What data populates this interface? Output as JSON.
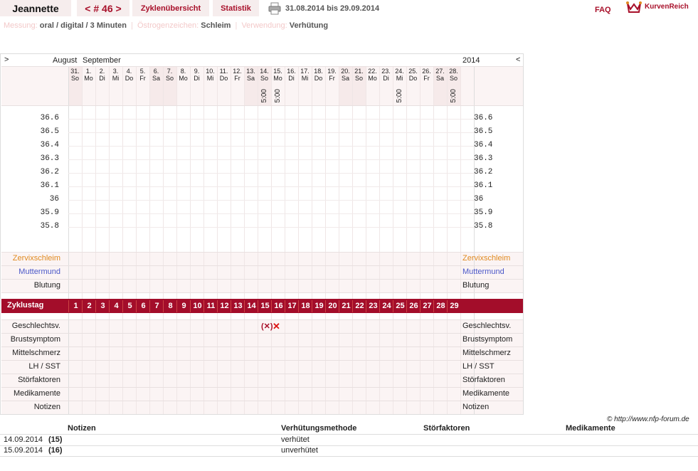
{
  "header": {
    "name": "Jeannette",
    "cycle_label": "< # 46 >",
    "overview_label": "Zyklenübersicht",
    "stats_label": "Statistik",
    "date_range": "31.08.2014 bis 29.09.2014",
    "faq_label": "FAQ",
    "logo_text": "KurvenReich",
    "accent_color": "#a8102a"
  },
  "subline": {
    "messung_label": "Messung:",
    "messung_value": "oral / digital / 3 Minuten",
    "oestrogen_label": "Östrogenzeichen:",
    "oestrogen_value": "Schleim",
    "verwendung_label": "Verwendung:",
    "verwendung_value": "Verhütung"
  },
  "chart": {
    "nav_left": ">",
    "nav_right": "<",
    "month1": "August",
    "month2": "September",
    "year": "2014",
    "days": [
      {
        "d": "31.",
        "w": "So",
        "wk": true
      },
      {
        "d": "1.",
        "w": "Mo"
      },
      {
        "d": "2.",
        "w": "Di"
      },
      {
        "d": "3.",
        "w": "Mi"
      },
      {
        "d": "4.",
        "w": "Do"
      },
      {
        "d": "5.",
        "w": "Fr"
      },
      {
        "d": "6.",
        "w": "Sa",
        "wk": true
      },
      {
        "d": "7.",
        "w": "So",
        "wk": true
      },
      {
        "d": "8.",
        "w": "Mo"
      },
      {
        "d": "9.",
        "w": "Di"
      },
      {
        "d": "10.",
        "w": "Mi"
      },
      {
        "d": "11.",
        "w": "Do"
      },
      {
        "d": "12.",
        "w": "Fr"
      },
      {
        "d": "13.",
        "w": "Sa",
        "wk": true
      },
      {
        "d": "14.",
        "w": "So",
        "wk": true,
        "t": "5:00"
      },
      {
        "d": "15.",
        "w": "Mo",
        "t": "5:00"
      },
      {
        "d": "16.",
        "w": "Di"
      },
      {
        "d": "17.",
        "w": "Mi"
      },
      {
        "d": "18.",
        "w": "Do"
      },
      {
        "d": "19.",
        "w": "Fr"
      },
      {
        "d": "20.",
        "w": "Sa",
        "wk": true
      },
      {
        "d": "21.",
        "w": "So",
        "wk": true
      },
      {
        "d": "22.",
        "w": "Mo"
      },
      {
        "d": "23.",
        "w": "Di"
      },
      {
        "d": "24.",
        "w": "Mi",
        "t": "5:00"
      },
      {
        "d": "25.",
        "w": "Do"
      },
      {
        "d": "26.",
        "w": "Fr"
      },
      {
        "d": "27.",
        "w": "Sa",
        "wk": true
      },
      {
        "d": "28.",
        "w": "So",
        "wk": true,
        "t": "5:00"
      }
    ],
    "temps": [
      "36.6",
      "36.5",
      "36.4",
      "36.3",
      "36.2",
      "36.1",
      "36",
      "35.9",
      "35.8"
    ],
    "labels": {
      "zervix": "Zervixschleim",
      "muttermund": "Muttermund",
      "blutung": "Blutung",
      "zyklustag": "Zyklustag",
      "geschlechtsv": "Geschlechtsv.",
      "brustsymptom": "Brustsymptom",
      "mittelschmerz": "Mittelschmerz",
      "lhsst": "LH / SST",
      "stoerfaktoren": "Störfaktoren",
      "medikamente": "Medikamente",
      "notizen": "Notizen"
    },
    "zervix_color": "#e08a20",
    "muttermund_color": "#4a57c8",
    "cycle_days": [
      "1",
      "2",
      "3",
      "4",
      "5",
      "6",
      "7",
      "8",
      "9",
      "10",
      "11",
      "12",
      "13",
      "14",
      "15",
      "16",
      "17",
      "18",
      "19",
      "20",
      "21",
      "22",
      "23",
      "24",
      "25",
      "26",
      "27",
      "28",
      "29"
    ],
    "intercourse_marks": {
      "protected": "(✕)",
      "unprotected": "✕"
    },
    "copyright": "© http://www.nfp-forum.de"
  },
  "notes_table": {
    "headers": [
      "Notizen",
      "Verhütungsmethode",
      "Störfaktoren",
      "Medikamente"
    ],
    "rows": [
      {
        "date": "14.09.2014",
        "day": "(15)",
        "method": "verhütet"
      },
      {
        "date": "15.09.2014",
        "day": "(16)",
        "method": "unverhütet"
      }
    ]
  }
}
